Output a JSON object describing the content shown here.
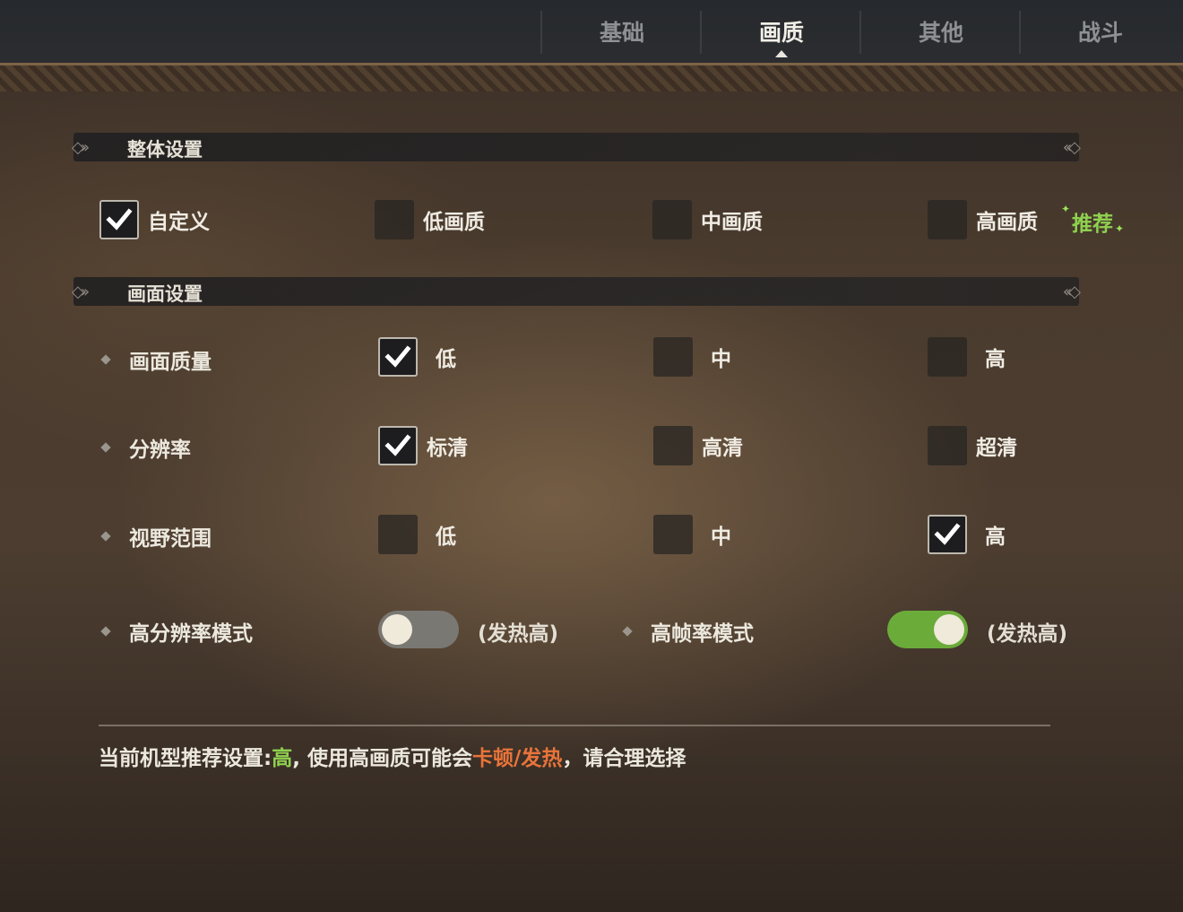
{
  "tabs": [
    {
      "label": "基础",
      "active": false
    },
    {
      "label": "画质",
      "active": true
    },
    {
      "label": "其他",
      "active": false
    },
    {
      "label": "战斗",
      "active": false
    }
  ],
  "sections": {
    "overall": {
      "title": "整体设置"
    },
    "display": {
      "title": "画面设置"
    }
  },
  "presets": {
    "options": [
      {
        "label": "自定义",
        "checked": true
      },
      {
        "label": "低画质",
        "checked": false
      },
      {
        "label": "中画质",
        "checked": false
      },
      {
        "label": "高画质",
        "checked": false
      }
    ],
    "recommend_badge": "推荐"
  },
  "settings": {
    "quality": {
      "label": "画面质量",
      "options": [
        "低",
        "中",
        "高"
      ],
      "selected": 0
    },
    "resolution": {
      "label": "分辨率",
      "options": [
        "标清",
        "高清",
        "超清"
      ],
      "selected": 0
    },
    "view_range": {
      "label": "视野范围",
      "options": [
        "低",
        "中",
        "高"
      ],
      "selected": 2
    },
    "high_res_mode": {
      "label": "高分辨率模式",
      "enabled": false,
      "note": "(发热高)"
    },
    "high_fps_mode": {
      "label": "高帧率模式",
      "enabled": true,
      "note": "(发热高)"
    }
  },
  "footer": {
    "prefix": "当前机型推荐设置:",
    "level": "高",
    "middle": ", 使用高画质可能会",
    "warning": "卡顿/发热",
    "suffix": "，请合理选择"
  },
  "colors": {
    "accent_green": "#8fd14f",
    "warning_orange": "#e8743a",
    "toggle_on": "#6bab3a"
  }
}
